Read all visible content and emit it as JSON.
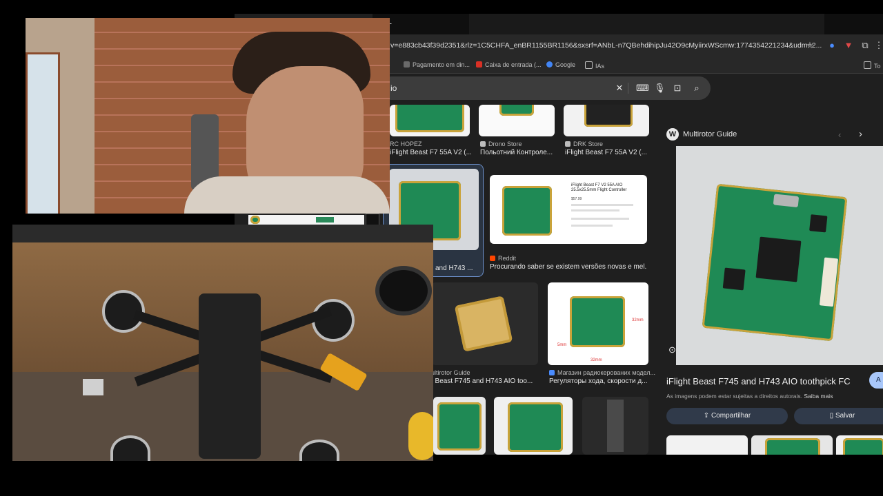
{
  "browser": {
    "new_tab_glyph": "+",
    "url": "v=e883cb43f39d2351&rlz=1C5CHFA_enBR1155BR1156&sxsrf=ANbL-n7QBehdihipJu42O9cMyiirxWScmw:1774354221234&udm=2...",
    "bookmarks": [
      "Pagamento em din...",
      "Caixa de entrada (...",
      "Google",
      "IAs",
      "To"
    ],
    "search_query": "io"
  },
  "results": {
    "row1": [
      {
        "source": "RC HOPEZ",
        "title": "iFlight Beast F7 55A V2 (..."
      },
      {
        "source": "Drono Store",
        "title": "Польотний Контроле..."
      },
      {
        "source": "DRK Store",
        "title": "iFlight Beast F7 55A V2 (..."
      }
    ],
    "selected": {
      "title": "and H743 ..."
    },
    "reddit": {
      "source": "Reddit",
      "title": "Procurando saber se existem versões novas e mel...",
      "doc_title": "iFlight Beast F7 V2 55A AIO 25.5x25.5mm Flight Controller",
      "doc_price": "$57.99"
    },
    "row3": [
      {
        "source": "ultirotor Guide",
        "title": "t Beast F745 and H743 AIO too..."
      },
      {
        "source": "Магазин радиокерованих модел...",
        "title": "Регуляторы хода, скорости д..."
      }
    ],
    "dims": {
      "height": "32mm",
      "width": "32mm",
      "hole": "5mm"
    }
  },
  "panel": {
    "source": "Multirotor Guide",
    "title": "iFlight Beast F745 and H743 AIO toothpick FC",
    "note": "As imagens podem estar sujeitas a direitos autorais.",
    "note_link": "Saiba mais",
    "share_label": "Compartilhar",
    "save_label": "Salvar",
    "visit_label": "A"
  },
  "colors": {
    "pcb_green": "#1f8a55",
    "pcb_gold": "#c9a33a",
    "panel_button": "#303a4a"
  }
}
